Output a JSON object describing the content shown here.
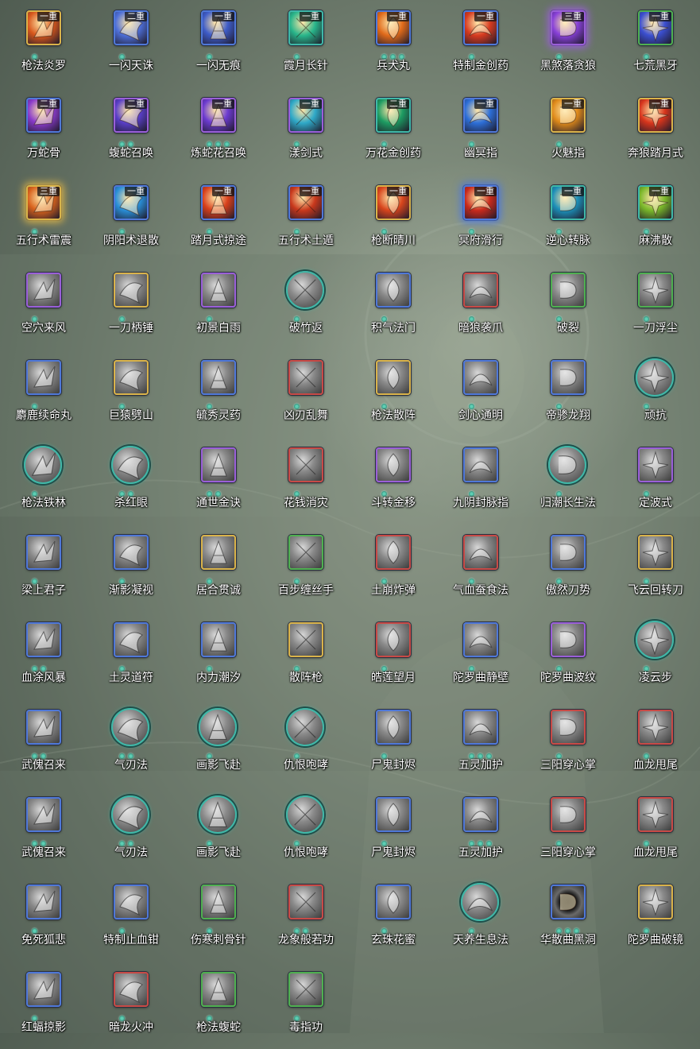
{
  "skills": [
    {
      "name": "枪法炎罗",
      "rank": "一重",
      "dots": 1,
      "frame": "gold",
      "color": "#d8571c",
      "shape": "square",
      "glow": false
    },
    {
      "name": "一闪天诛",
      "rank": "二重",
      "dots": 1,
      "frame": "blue",
      "color": "#4e6fd8",
      "shape": "square",
      "glow": false
    },
    {
      "name": "一闪无痕",
      "rank": "一重",
      "dots": 1,
      "frame": "blue",
      "color": "#3e5cc8",
      "shape": "square",
      "glow": false
    },
    {
      "name": "霞月长针",
      "rank": "一重",
      "dots": 1,
      "frame": "teal",
      "color": "#28b58a",
      "shape": "square",
      "glow": false
    },
    {
      "name": "兵犬丸",
      "rank": "一重",
      "dots": 3,
      "frame": "blue",
      "color": "#e06a1a",
      "shape": "square",
      "glow": false
    },
    {
      "name": "特制金创药",
      "rank": "一重",
      "dots": 1,
      "frame": "blue",
      "color": "#d63a1f",
      "shape": "square",
      "glow": false
    },
    {
      "name": "黑煞落贪狼",
      "rank": "三重",
      "dots": 1,
      "frame": "purple",
      "color": "#8840d8",
      "shape": "square",
      "glow": true
    },
    {
      "name": "七荒黑牙",
      "rank": "一重",
      "dots": 1,
      "frame": "green",
      "color": "#3b4fd0",
      "shape": "square",
      "glow": false
    },
    {
      "name": "万蛇骨",
      "rank": "二重",
      "dots": 2,
      "frame": "blue",
      "color": "#8a3acb",
      "shape": "square",
      "glow": false
    },
    {
      "name": "蝮蛇召唤",
      "rank": "二重",
      "dots": 2,
      "frame": "purple",
      "color": "#5a3fc8",
      "shape": "square",
      "glow": false
    },
    {
      "name": "炼蛇花召唤",
      "rank": "一重",
      "dots": 3,
      "frame": "purple",
      "color": "#6c3bd0",
      "shape": "square",
      "glow": false
    },
    {
      "name": "漾剑式",
      "rank": "一重",
      "dots": 1,
      "frame": "purple",
      "color": "#2fa9c8",
      "shape": "square",
      "glow": false
    },
    {
      "name": "万花金创药",
      "rank": "二重",
      "dots": 1,
      "frame": "teal",
      "color": "#1d9c62",
      "shape": "square",
      "glow": false
    },
    {
      "name": "幽冥指",
      "rank": "一重",
      "dots": 1,
      "frame": "blue",
      "color": "#2d6fd8",
      "shape": "square",
      "glow": false
    },
    {
      "name": "火魅指",
      "rank": "一重",
      "dots": 1,
      "frame": "gold",
      "color": "#e08a1a",
      "shape": "square",
      "glow": false
    },
    {
      "name": "奔狼踏月式",
      "rank": "一重",
      "dots": 1,
      "frame": "gold",
      "color": "#d8351c",
      "shape": "square",
      "glow": false
    },
    {
      "name": "五行术雷震",
      "rank": "三重",
      "dots": 1,
      "frame": "gold",
      "color": "#d8621c",
      "shape": "square",
      "glow": true
    },
    {
      "name": "阴阳术退散",
      "rank": "一重",
      "dots": 1,
      "frame": "blue",
      "color": "#2a8fd8",
      "shape": "square",
      "glow": false
    },
    {
      "name": "踏月式掠途",
      "rank": "一重",
      "dots": 1,
      "frame": "blue",
      "color": "#d8401c",
      "shape": "square",
      "glow": false
    },
    {
      "name": "五行术土遁",
      "rank": "一重",
      "dots": 1,
      "frame": "blue",
      "color": "#c8381c",
      "shape": "square",
      "glow": false
    },
    {
      "name": "枪断晴川",
      "rank": "一重",
      "dots": 1,
      "frame": "gold",
      "color": "#d8451c",
      "shape": "square",
      "glow": false
    },
    {
      "name": "冥府滑行",
      "rank": "一重",
      "dots": 1,
      "frame": "blue",
      "color": "#c82a1c",
      "shape": "square",
      "glow": true
    },
    {
      "name": "逆心转脉",
      "rank": "一重",
      "dots": 1,
      "frame": "teal",
      "color": "#1d8fb8",
      "shape": "square",
      "glow": false
    },
    {
      "name": "麻沸散",
      "rank": "一重",
      "dots": 1,
      "frame": "teal",
      "color": "#7ab82a",
      "shape": "square",
      "glow": false
    },
    {
      "name": "空穴来风",
      "rank": "",
      "dots": 1,
      "frame": "purple",
      "color": "#8c8c8c",
      "shape": "square",
      "glow": false
    },
    {
      "name": "一刀柄锤",
      "rank": "",
      "dots": 1,
      "frame": "gold",
      "color": "#8c8c8c",
      "shape": "square",
      "glow": false
    },
    {
      "name": "初景白雨",
      "rank": "",
      "dots": 1,
      "frame": "purple",
      "color": "#8c8c8c",
      "shape": "square",
      "glow": false
    },
    {
      "name": "破竹返",
      "rank": "",
      "dots": 1,
      "frame": "teal",
      "color": "#7c7c7c",
      "shape": "round",
      "glow": false
    },
    {
      "name": "积气法门",
      "rank": "",
      "dots": 1,
      "frame": "blue",
      "color": "#8c8c8c",
      "shape": "square",
      "glow": false
    },
    {
      "name": "暗狼袭爪",
      "rank": "",
      "dots": 1,
      "frame": "red",
      "color": "#8c8c8c",
      "shape": "square",
      "glow": false
    },
    {
      "name": "破裂",
      "rank": "",
      "dots": 1,
      "frame": "green",
      "color": "#8c8c8c",
      "shape": "square",
      "glow": false
    },
    {
      "name": "一刀浮尘",
      "rank": "",
      "dots": 1,
      "frame": "green",
      "color": "#8c8c8c",
      "shape": "square",
      "glow": false
    },
    {
      "name": "麝鹿续命丸",
      "rank": "",
      "dots": 1,
      "frame": "blue",
      "color": "#8c8c8c",
      "shape": "square",
      "glow": false
    },
    {
      "name": "巨猿劈山",
      "rank": "",
      "dots": 1,
      "frame": "gold",
      "color": "#8c8c8c",
      "shape": "square",
      "glow": false
    },
    {
      "name": "毓秀灵药",
      "rank": "",
      "dots": 1,
      "frame": "blue",
      "color": "#8c8c8c",
      "shape": "square",
      "glow": false
    },
    {
      "name": "凶刃乱舞",
      "rank": "",
      "dots": 1,
      "frame": "red",
      "color": "#8c8c8c",
      "shape": "square",
      "glow": false
    },
    {
      "name": "枪法散阵",
      "rank": "",
      "dots": 1,
      "frame": "gold",
      "color": "#8c8c8c",
      "shape": "square",
      "glow": false
    },
    {
      "name": "剑心通明",
      "rank": "",
      "dots": 1,
      "frame": "blue",
      "color": "#8c8c8c",
      "shape": "square",
      "glow": false
    },
    {
      "name": "帝骖龙翔",
      "rank": "",
      "dots": 1,
      "frame": "blue",
      "color": "#8c8c8c",
      "shape": "square",
      "glow": false
    },
    {
      "name": "顽抗",
      "rank": "",
      "dots": 1,
      "frame": "teal",
      "color": "#7c7c7c",
      "shape": "round",
      "glow": false
    },
    {
      "name": "枪法铁林",
      "rank": "",
      "dots": 1,
      "frame": "teal",
      "color": "#7c7c7c",
      "shape": "round",
      "glow": false
    },
    {
      "name": "杀红眼",
      "rank": "",
      "dots": 2,
      "frame": "teal",
      "color": "#7c7c7c",
      "shape": "round",
      "glow": false
    },
    {
      "name": "通世金诀",
      "rank": "",
      "dots": 2,
      "frame": "purple",
      "color": "#8c8c8c",
      "shape": "square",
      "glow": false
    },
    {
      "name": "花钱消灾",
      "rank": "",
      "dots": 1,
      "frame": "red",
      "color": "#8c8c8c",
      "shape": "square",
      "glow": false
    },
    {
      "name": "斗转金移",
      "rank": "",
      "dots": 1,
      "frame": "purple",
      "color": "#8c8c8c",
      "shape": "square",
      "glow": false
    },
    {
      "name": "九阴封脉指",
      "rank": "",
      "dots": 1,
      "frame": "blue",
      "color": "#8c8c8c",
      "shape": "square",
      "glow": false
    },
    {
      "name": "归潮长生法",
      "rank": "",
      "dots": 1,
      "frame": "teal",
      "color": "#7c7c7c",
      "shape": "round",
      "glow": false
    },
    {
      "name": "定波式",
      "rank": "",
      "dots": 1,
      "frame": "purple",
      "color": "#8c8c8c",
      "shape": "square",
      "glow": false
    },
    {
      "name": "梁上君子",
      "rank": "",
      "dots": 1,
      "frame": "blue",
      "color": "#8c8c8c",
      "shape": "square",
      "glow": false
    },
    {
      "name": "渐影凝视",
      "rank": "",
      "dots": 1,
      "frame": "blue",
      "color": "#8c8c8c",
      "shape": "square",
      "glow": false
    },
    {
      "name": "居合贯诚",
      "rank": "",
      "dots": 1,
      "frame": "gold",
      "color": "#8c8c8c",
      "shape": "square",
      "glow": false
    },
    {
      "name": "百步缠丝手",
      "rank": "",
      "dots": 1,
      "frame": "green",
      "color": "#8c8c8c",
      "shape": "square",
      "glow": false
    },
    {
      "name": "土崩炸弹",
      "rank": "",
      "dots": 1,
      "frame": "red",
      "color": "#8c8c8c",
      "shape": "square",
      "glow": false
    },
    {
      "name": "气血蚕食法",
      "rank": "",
      "dots": 1,
      "frame": "red",
      "color": "#8c8c8c",
      "shape": "square",
      "glow": false
    },
    {
      "name": "傲然刀势",
      "rank": "",
      "dots": 1,
      "frame": "blue",
      "color": "#8c8c8c",
      "shape": "square",
      "glow": false
    },
    {
      "name": "飞云回转刀",
      "rank": "",
      "dots": 1,
      "frame": "gold",
      "color": "#8c8c8c",
      "shape": "square",
      "glow": false
    },
    {
      "name": "血涂风暴",
      "rank": "",
      "dots": 2,
      "frame": "blue",
      "color": "#8c8c8c",
      "shape": "square",
      "glow": false
    },
    {
      "name": "土灵道符",
      "rank": "",
      "dots": 1,
      "frame": "blue",
      "color": "#8c8c8c",
      "shape": "square",
      "glow": false
    },
    {
      "name": "内力潮汐",
      "rank": "",
      "dots": 1,
      "frame": "blue",
      "color": "#8c8c8c",
      "shape": "square",
      "glow": false
    },
    {
      "name": "散阵枪",
      "rank": "",
      "dots": 1,
      "frame": "gold",
      "color": "#8c8c8c",
      "shape": "square",
      "glow": false
    },
    {
      "name": "皓莲望月",
      "rank": "",
      "dots": 1,
      "frame": "red",
      "color": "#8c8c8c",
      "shape": "square",
      "glow": false
    },
    {
      "name": "陀罗曲静壁",
      "rank": "",
      "dots": 1,
      "frame": "blue",
      "color": "#8c8c8c",
      "shape": "square",
      "glow": false
    },
    {
      "name": "陀罗曲波纹",
      "rank": "",
      "dots": 1,
      "frame": "purple",
      "color": "#8c8c8c",
      "shape": "square",
      "glow": false
    },
    {
      "name": "凌云步",
      "rank": "",
      "dots": 1,
      "frame": "teal",
      "color": "#7c7c7c",
      "shape": "round",
      "glow": false
    },
    {
      "name": "武傀召来",
      "rank": "",
      "dots": 2,
      "frame": "blue",
      "color": "#8c8c8c",
      "shape": "square",
      "glow": false
    },
    {
      "name": "气刃法",
      "rank": "",
      "dots": 2,
      "frame": "teal",
      "color": "#7c7c7c",
      "shape": "round",
      "glow": false
    },
    {
      "name": "画影飞赴",
      "rank": "",
      "dots": 1,
      "frame": "teal",
      "color": "#7c7c7c",
      "shape": "round",
      "glow": false
    },
    {
      "name": "仇恨咆哮",
      "rank": "",
      "dots": 1,
      "frame": "teal",
      "color": "#7c7c7c",
      "shape": "round",
      "glow": false
    },
    {
      "name": "尸鬼封烬",
      "rank": "",
      "dots": 1,
      "frame": "blue",
      "color": "#8c8c8c",
      "shape": "square",
      "glow": false
    },
    {
      "name": "五灵加护",
      "rank": "",
      "dots": 3,
      "frame": "blue",
      "color": "#8c8c8c",
      "shape": "square",
      "glow": false
    },
    {
      "name": "三阳穿心掌",
      "rank": "",
      "dots": 1,
      "frame": "red",
      "color": "#8c8c8c",
      "shape": "square",
      "glow": false
    },
    {
      "name": "血龙甩尾",
      "rank": "",
      "dots": 1,
      "frame": "red",
      "color": "#8c8c8c",
      "shape": "square",
      "glow": false
    },
    {
      "name": "武傀召来",
      "rank": "",
      "dots": 2,
      "frame": "blue",
      "color": "#8c8c8c",
      "shape": "square",
      "glow": false
    },
    {
      "name": "气刃法",
      "rank": "",
      "dots": 2,
      "frame": "teal",
      "color": "#7c7c7c",
      "shape": "round",
      "glow": false
    },
    {
      "name": "画影飞赴",
      "rank": "",
      "dots": 1,
      "frame": "teal",
      "color": "#7c7c7c",
      "shape": "round",
      "glow": false
    },
    {
      "name": "仇恨咆哮",
      "rank": "",
      "dots": 1,
      "frame": "teal",
      "color": "#7c7c7c",
      "shape": "round",
      "glow": false
    },
    {
      "name": "尸鬼封烬",
      "rank": "",
      "dots": 1,
      "frame": "blue",
      "color": "#8c8c8c",
      "shape": "square",
      "glow": false
    },
    {
      "name": "五灵加护",
      "rank": "",
      "dots": 3,
      "frame": "blue",
      "color": "#8c8c8c",
      "shape": "square",
      "glow": false
    },
    {
      "name": "三阳穿心掌",
      "rank": "",
      "dots": 1,
      "frame": "red",
      "color": "#8c8c8c",
      "shape": "square",
      "glow": false
    },
    {
      "name": "血龙甩尾",
      "rank": "",
      "dots": 1,
      "frame": "red",
      "color": "#8c8c8c",
      "shape": "square",
      "glow": false
    },
    {
      "name": "免死狐悲",
      "rank": "",
      "dots": 1,
      "frame": "blue",
      "color": "#8c8c8c",
      "shape": "square",
      "glow": false
    },
    {
      "name": "特制止血钳",
      "rank": "",
      "dots": 1,
      "frame": "blue",
      "color": "#8c8c8c",
      "shape": "square",
      "glow": false
    },
    {
      "name": "伤寒刺骨针",
      "rank": "",
      "dots": 1,
      "frame": "green",
      "color": "#8c8c8c",
      "shape": "square",
      "glow": false
    },
    {
      "name": "龙象般若功",
      "rank": "",
      "dots": 2,
      "frame": "red",
      "color": "#8c8c8c",
      "shape": "square",
      "glow": false
    },
    {
      "name": "玄珠花蜜",
      "rank": "",
      "dots": 1,
      "frame": "blue",
      "color": "#8c8c8c",
      "shape": "square",
      "glow": false
    },
    {
      "name": "天养生息法",
      "rank": "",
      "dots": 1,
      "frame": "teal",
      "color": "#7c7c7c",
      "shape": "round",
      "glow": false
    },
    {
      "name": "华散曲黑洞",
      "rank": "",
      "dots": 3,
      "frame": "blue",
      "color": "#1a1a1a",
      "shape": "square",
      "glow": false
    },
    {
      "name": "陀罗曲破镜",
      "rank": "",
      "dots": 1,
      "frame": "gold",
      "color": "#8c8c8c",
      "shape": "square",
      "glow": false
    },
    {
      "name": "红蝠掠影",
      "rank": "",
      "dots": 1,
      "frame": "blue",
      "color": "#8c8c8c",
      "shape": "square",
      "glow": false
    },
    {
      "name": "暗龙火冲",
      "rank": "",
      "dots": 1,
      "frame": "red",
      "color": "#8c8c8c",
      "shape": "square",
      "glow": false
    },
    {
      "name": "枪法蝮蛇",
      "rank": "",
      "dots": 1,
      "frame": "green",
      "color": "#8c8c8c",
      "shape": "square",
      "glow": false
    },
    {
      "name": "毒指功",
      "rank": "",
      "dots": 1,
      "frame": "green",
      "color": "#8c8c8c",
      "shape": "square",
      "glow": false
    }
  ],
  "frame_colors": {
    "gold": "#d9b34a",
    "blue": "#4f78d8",
    "purple": "#9a5fd8",
    "teal": "#3fb8a8",
    "green": "#4fb050",
    "red": "#c84a46"
  }
}
